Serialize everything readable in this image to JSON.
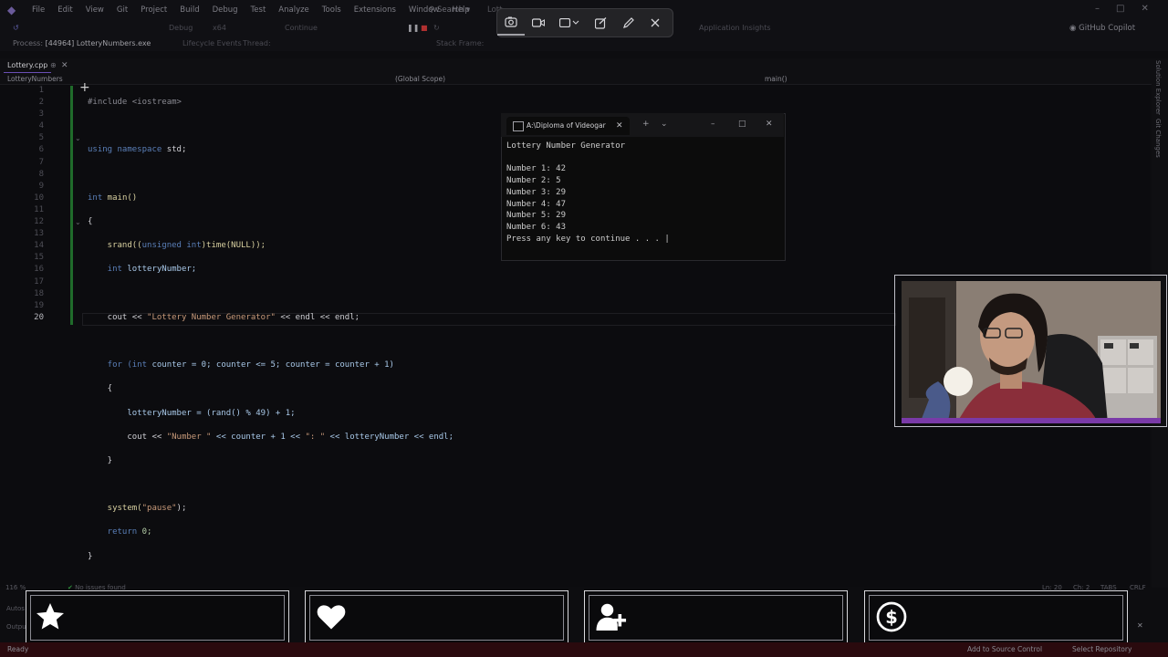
{
  "menu": [
    "File",
    "Edit",
    "View",
    "Git",
    "Project",
    "Build",
    "Debug",
    "Test",
    "Analyze",
    "Tools",
    "Extensions",
    "Window",
    "Help"
  ],
  "search_label": "Search",
  "window_title": "Lott...",
  "github_copilot": "GitHub Copilot",
  "toolbar": {
    "config": "Debug",
    "platform": "x64",
    "continue_label": "Continue",
    "app_insights": "Application Insights"
  },
  "process": {
    "label": "Process:",
    "value": "[44964] LotteryNumbers.exe",
    "lifecycle": "Lifecycle Events",
    "thread": "Thread:",
    "stack_frame": "Stack Frame:"
  },
  "tab": {
    "file": "Lottery.cpp"
  },
  "nav": {
    "project": "LotteryNumbers",
    "scope": "(Global Scope)",
    "member": "main()"
  },
  "side_tabs": [
    "Solution Explorer",
    "Git Changes"
  ],
  "code_lines": [
    {
      "n": "1"
    },
    {
      "n": "2"
    },
    {
      "n": "3"
    },
    {
      "n": "4"
    },
    {
      "n": "5"
    },
    {
      "n": "6"
    },
    {
      "n": "7"
    },
    {
      "n": "8"
    },
    {
      "n": "9"
    },
    {
      "n": "10"
    },
    {
      "n": "11"
    },
    {
      "n": "12"
    },
    {
      "n": "13"
    },
    {
      "n": "14"
    },
    {
      "n": "15"
    },
    {
      "n": "16"
    },
    {
      "n": "17"
    },
    {
      "n": "18"
    },
    {
      "n": "19"
    },
    {
      "n": "20"
    }
  ],
  "code": {
    "l1": "#include <iostream>",
    "l3a": "using namespace",
    "l3b": " std;",
    "l5a": "int",
    "l5b": " main()",
    "l6": "{",
    "l7a": "    srand((",
    "l7b": "unsigned int",
    "l7c": ")time(NULL));",
    "l8a": "    int",
    "l8b": " lotteryNumber;",
    "l10a": "    cout << ",
    "l10b": "\"Lottery Number Generator\"",
    "l10c": " << endl << endl;",
    "l12a": "    for (",
    "l12b": "int",
    "l12c": " counter = 0; counter <= 5; counter = counter + 1)",
    "l13": "    {",
    "l14": "        lotteryNumber = (rand() % 49) + 1;",
    "l15a": "        cout << ",
    "l15b": "\"Number \"",
    "l15c": " << counter + 1 << ",
    "l15d": "\": \"",
    "l15e": " << lotteryNumber << endl;",
    "l16": "    }",
    "l18a": "    system(",
    "l18b": "\"pause\"",
    "l18c": ");",
    "l19a": "    return",
    "l19b": " 0;",
    "l20": "}"
  },
  "console": {
    "tab_title": "A:\\Diploma of Videogar",
    "lines": "Lottery Number Generator\n\nNumber 1: 42\nNumber 2: 5\nNumber 3: 29\nNumber 4: 47\nNumber 5: 29\nNumber 6: 43\nPress any key to continue . . . |"
  },
  "editor_status": {
    "zoom": "116 %",
    "issues": "No issues found",
    "ln": "Ln: 20",
    "ch": "Ch: 2",
    "tabs": "TABS",
    "crlf": "CRLF"
  },
  "bottom_panels": {
    "autos": "Autos",
    "output": "Output"
  },
  "statusbar": {
    "ready": "Ready",
    "add_source": "Add to Source Control",
    "select_repo": "Select Repository"
  },
  "stream_icons": [
    "star-icon",
    "heart-icon",
    "add-user-icon",
    "dollar-icon"
  ],
  "colors": {
    "accent": "#6a4fb4",
    "status_bg": "#2a0a0e",
    "git_gutter": "#1f6b2a"
  }
}
